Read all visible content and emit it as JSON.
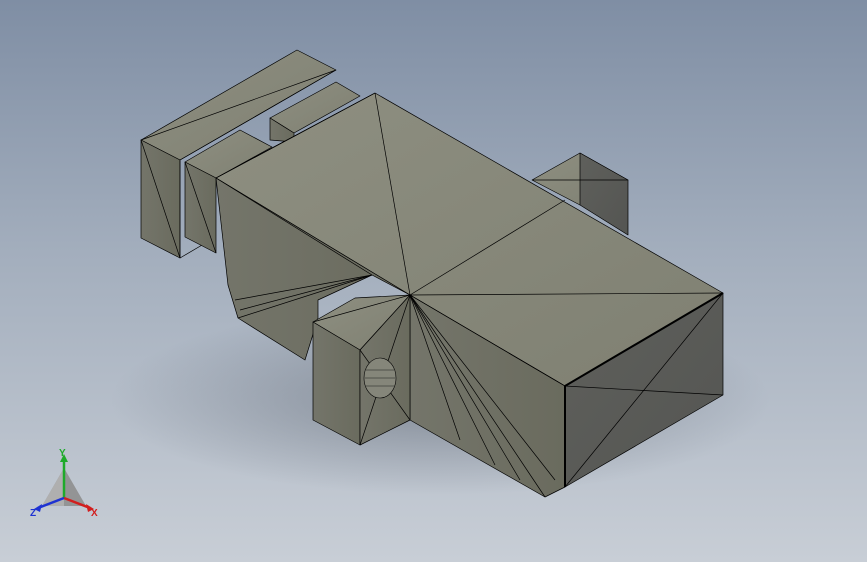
{
  "viewport": {
    "background_top": "#7f8ea4",
    "background_bottom": "#c8ced6"
  },
  "model": {
    "face_color_top": "#898a7c",
    "face_color_side": "#6d6e60",
    "face_color_dark": "#5b5c58",
    "edge_color": "#000000"
  },
  "triad": {
    "x_label": "X",
    "y_label": "Y",
    "z_label": "Z",
    "x_color": "#d21e1e",
    "y_color": "#1eaa2a",
    "z_color": "#1e32d2"
  }
}
